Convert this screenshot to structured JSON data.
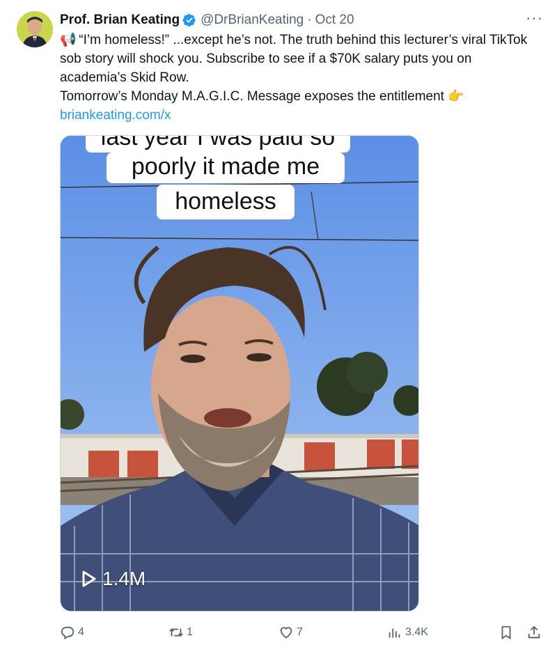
{
  "author": {
    "display_name": "Prof. Brian Keating",
    "handle": "@DrBrianKeating",
    "separator": "·",
    "date": "Oct 20",
    "verified_icon": "verified-badge-icon",
    "avatar_bg": "#c9d64a"
  },
  "more_label": "···",
  "tweet": {
    "megaphone_emoji": "📢",
    "line1": " “I’m homeless!” ...except he’s not. The truth behind this lecturer’s viral TikTok sob story will shock you. Subscribe to see if a $70K salary puts you on academia’s Skid Row.",
    "line2": "Tomorrow’s Monday M.A.G.I.C. Message exposes the entitlement ",
    "pointing_emoji": "👉",
    "link": "briankeating.com/x"
  },
  "media": {
    "caption_line1": "last year I was paid so",
    "caption_line2": "poorly it made me",
    "caption_line3": "homeless",
    "view_count": "1.4M",
    "play_icon": "play-icon"
  },
  "actions": {
    "reply_count": "4",
    "retweet_count": "1",
    "like_count": "7",
    "views_count": "3.4K"
  },
  "colors": {
    "link": "#1d9bf0",
    "muted": "#536471",
    "verified": "#1d9bf0"
  }
}
